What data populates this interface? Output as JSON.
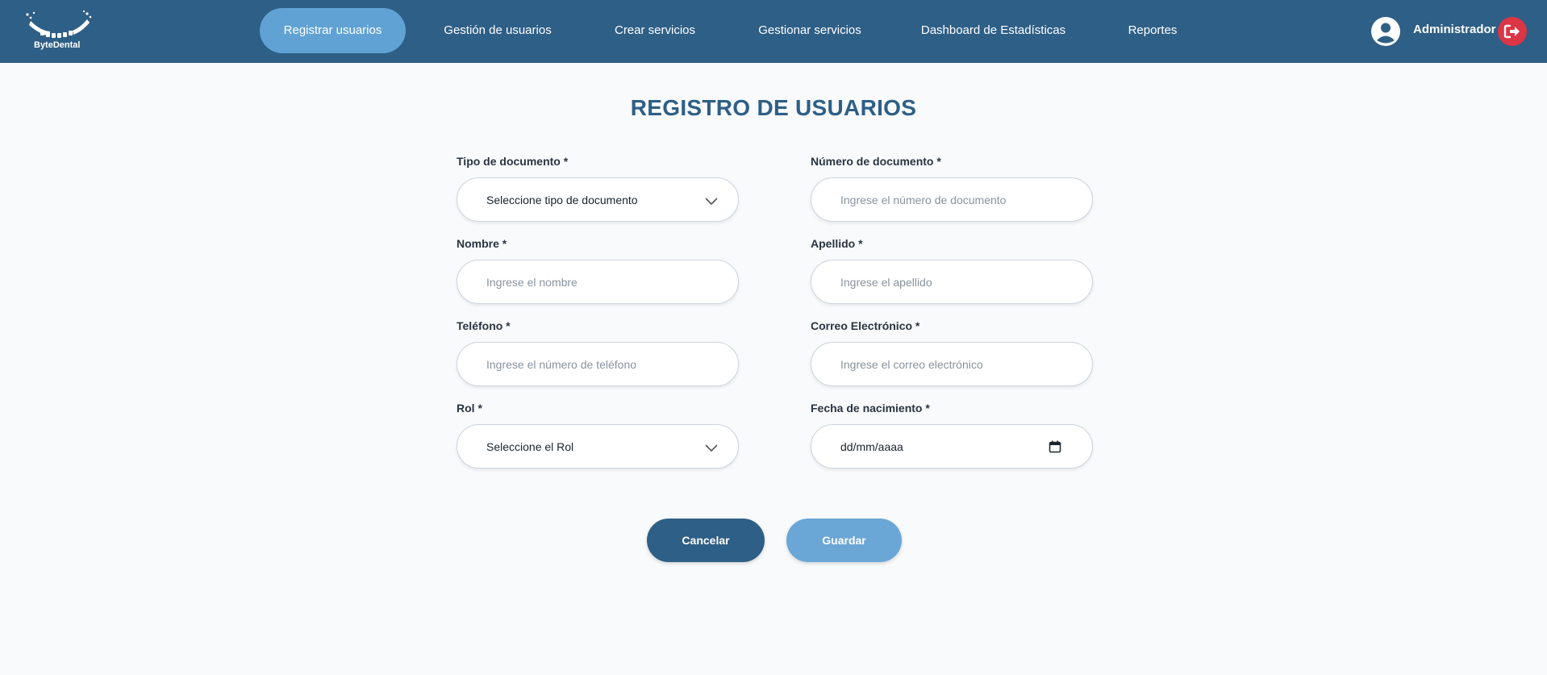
{
  "brand": {
    "logo_text": "ByteDental"
  },
  "nav": {
    "items": [
      {
        "label": "Registrar usuarios"
      },
      {
        "label": "Gestión de usuarios"
      },
      {
        "label": "Crear servicios"
      },
      {
        "label": "Gestionar servicios"
      },
      {
        "label": "Dashboard de Estadísticas"
      },
      {
        "label": "Reportes"
      }
    ],
    "active_index": 0
  },
  "user": {
    "name": "Administrador",
    "icon": "user-circle-icon",
    "logout_icon": "logout-icon"
  },
  "form": {
    "title": "REGISTRO DE USUARIOS",
    "fields": {
      "tipo_documento": {
        "label": "Tipo de documento *",
        "value": "Seleccione tipo de documento"
      },
      "numero_documento": {
        "label": "Número de documento *",
        "placeholder": "Ingrese el número de documento"
      },
      "nombre": {
        "label": "Nombre *",
        "placeholder": "Ingrese el nombre"
      },
      "apellido": {
        "label": "Apellido *",
        "placeholder": "Ingrese el apellido"
      },
      "telefono": {
        "label": "Teléfono *",
        "placeholder": "Ingrese el número de teléfono"
      },
      "correo": {
        "label": "Correo Electrónico *",
        "placeholder": "Ingrese el correo electrónico"
      },
      "rol": {
        "label": "Rol *",
        "value": "Seleccione el Rol"
      },
      "fecha_nacimiento": {
        "label": "Fecha de nacimiento *",
        "value": "dd/mm/aaaa"
      }
    },
    "buttons": {
      "cancel": "Cancelar",
      "save": "Guardar"
    }
  },
  "colors": {
    "navbar": "#2e5f86",
    "nav_active": "#60a2d4",
    "title": "#2e5f86",
    "cancel_button": "#2e5f86",
    "save_button": "#6aa6d6",
    "logout": "#dc3545",
    "background": "#f8fafc"
  }
}
